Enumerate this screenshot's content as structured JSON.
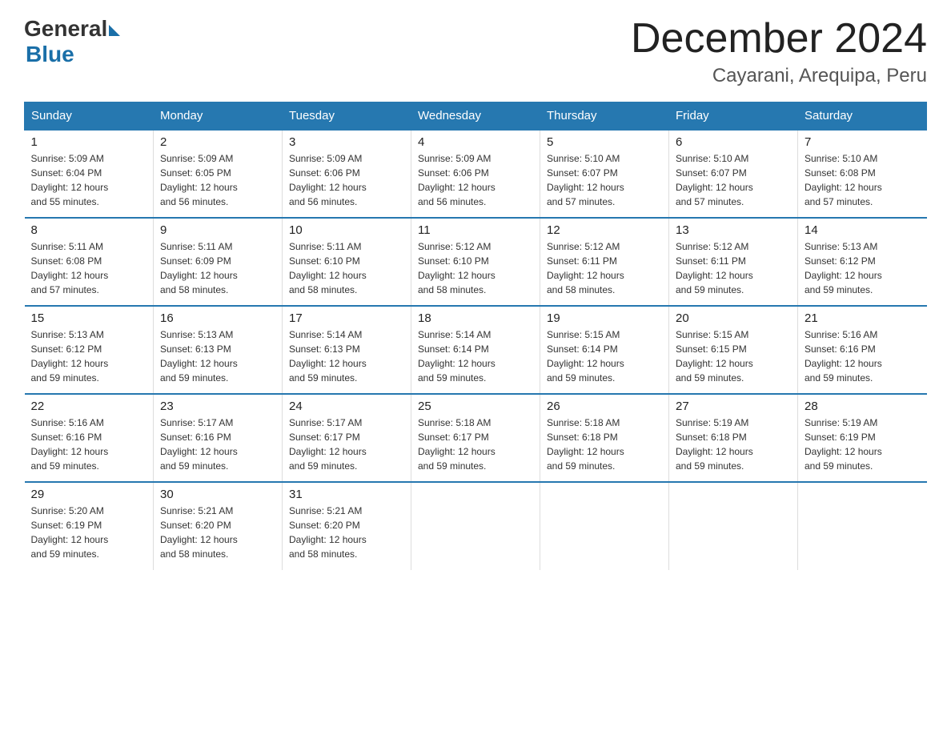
{
  "header": {
    "logo_general": "General",
    "logo_blue": "Blue",
    "title": "December 2024",
    "subtitle": "Cayarani, Arequipa, Peru"
  },
  "days_of_week": [
    "Sunday",
    "Monday",
    "Tuesday",
    "Wednesday",
    "Thursday",
    "Friday",
    "Saturday"
  ],
  "weeks": [
    [
      {
        "day": "1",
        "sunrise": "5:09 AM",
        "sunset": "6:04 PM",
        "daylight": "12 hours and 55 minutes."
      },
      {
        "day": "2",
        "sunrise": "5:09 AM",
        "sunset": "6:05 PM",
        "daylight": "12 hours and 56 minutes."
      },
      {
        "day": "3",
        "sunrise": "5:09 AM",
        "sunset": "6:06 PM",
        "daylight": "12 hours and 56 minutes."
      },
      {
        "day": "4",
        "sunrise": "5:09 AM",
        "sunset": "6:06 PM",
        "daylight": "12 hours and 56 minutes."
      },
      {
        "day": "5",
        "sunrise": "5:10 AM",
        "sunset": "6:07 PM",
        "daylight": "12 hours and 57 minutes."
      },
      {
        "day": "6",
        "sunrise": "5:10 AM",
        "sunset": "6:07 PM",
        "daylight": "12 hours and 57 minutes."
      },
      {
        "day": "7",
        "sunrise": "5:10 AM",
        "sunset": "6:08 PM",
        "daylight": "12 hours and 57 minutes."
      }
    ],
    [
      {
        "day": "8",
        "sunrise": "5:11 AM",
        "sunset": "6:08 PM",
        "daylight": "12 hours and 57 minutes."
      },
      {
        "day": "9",
        "sunrise": "5:11 AM",
        "sunset": "6:09 PM",
        "daylight": "12 hours and 58 minutes."
      },
      {
        "day": "10",
        "sunrise": "5:11 AM",
        "sunset": "6:10 PM",
        "daylight": "12 hours and 58 minutes."
      },
      {
        "day": "11",
        "sunrise": "5:12 AM",
        "sunset": "6:10 PM",
        "daylight": "12 hours and 58 minutes."
      },
      {
        "day": "12",
        "sunrise": "5:12 AM",
        "sunset": "6:11 PM",
        "daylight": "12 hours and 58 minutes."
      },
      {
        "day": "13",
        "sunrise": "5:12 AM",
        "sunset": "6:11 PM",
        "daylight": "12 hours and 59 minutes."
      },
      {
        "day": "14",
        "sunrise": "5:13 AM",
        "sunset": "6:12 PM",
        "daylight": "12 hours and 59 minutes."
      }
    ],
    [
      {
        "day": "15",
        "sunrise": "5:13 AM",
        "sunset": "6:12 PM",
        "daylight": "12 hours and 59 minutes."
      },
      {
        "day": "16",
        "sunrise": "5:13 AM",
        "sunset": "6:13 PM",
        "daylight": "12 hours and 59 minutes."
      },
      {
        "day": "17",
        "sunrise": "5:14 AM",
        "sunset": "6:13 PM",
        "daylight": "12 hours and 59 minutes."
      },
      {
        "day": "18",
        "sunrise": "5:14 AM",
        "sunset": "6:14 PM",
        "daylight": "12 hours and 59 minutes."
      },
      {
        "day": "19",
        "sunrise": "5:15 AM",
        "sunset": "6:14 PM",
        "daylight": "12 hours and 59 minutes."
      },
      {
        "day": "20",
        "sunrise": "5:15 AM",
        "sunset": "6:15 PM",
        "daylight": "12 hours and 59 minutes."
      },
      {
        "day": "21",
        "sunrise": "5:16 AM",
        "sunset": "6:16 PM",
        "daylight": "12 hours and 59 minutes."
      }
    ],
    [
      {
        "day": "22",
        "sunrise": "5:16 AM",
        "sunset": "6:16 PM",
        "daylight": "12 hours and 59 minutes."
      },
      {
        "day": "23",
        "sunrise": "5:17 AM",
        "sunset": "6:16 PM",
        "daylight": "12 hours and 59 minutes."
      },
      {
        "day": "24",
        "sunrise": "5:17 AM",
        "sunset": "6:17 PM",
        "daylight": "12 hours and 59 minutes."
      },
      {
        "day": "25",
        "sunrise": "5:18 AM",
        "sunset": "6:17 PM",
        "daylight": "12 hours and 59 minutes."
      },
      {
        "day": "26",
        "sunrise": "5:18 AM",
        "sunset": "6:18 PM",
        "daylight": "12 hours and 59 minutes."
      },
      {
        "day": "27",
        "sunrise": "5:19 AM",
        "sunset": "6:18 PM",
        "daylight": "12 hours and 59 minutes."
      },
      {
        "day": "28",
        "sunrise": "5:19 AM",
        "sunset": "6:19 PM",
        "daylight": "12 hours and 59 minutes."
      }
    ],
    [
      {
        "day": "29",
        "sunrise": "5:20 AM",
        "sunset": "6:19 PM",
        "daylight": "12 hours and 59 minutes."
      },
      {
        "day": "30",
        "sunrise": "5:21 AM",
        "sunset": "6:20 PM",
        "daylight": "12 hours and 58 minutes."
      },
      {
        "day": "31",
        "sunrise": "5:21 AM",
        "sunset": "6:20 PM",
        "daylight": "12 hours and 58 minutes."
      },
      null,
      null,
      null,
      null
    ]
  ],
  "labels": {
    "sunrise": "Sunrise:",
    "sunset": "Sunset:",
    "daylight": "Daylight:"
  }
}
